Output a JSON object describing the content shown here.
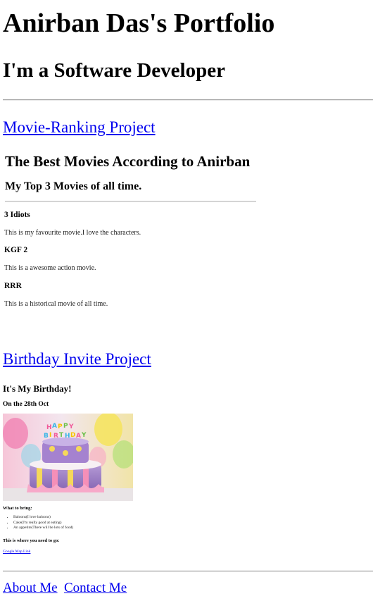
{
  "header": {
    "title": "Anirban Das's Portfolio",
    "subtitle": "I'm a Software Developer"
  },
  "projects": {
    "movie_link": "Movie-Ranking Project",
    "birthday_link": "Birthday Invite Project"
  },
  "movie_ranking": {
    "heading": "The Best Movies According to Anirban",
    "subheading": "My Top 3 Movies of all time.",
    "movies": [
      {
        "title": "3 Idiots",
        "description": "This is my favourite movie.I love the characters."
      },
      {
        "title": "KGF 2",
        "description": "This is a awesome action movie."
      },
      {
        "title": "RRR",
        "description": "This is a historical movie of all time."
      }
    ]
  },
  "birthday_invite": {
    "heading": "It's My Birthday!",
    "date": "On the 28th Oct",
    "image_text": "HAPPY BIRTHDAY",
    "bring_label": "What to bring:",
    "items": [
      "Baloons(I love baloons)",
      "Cake(I'm really good at eating)",
      "An appetite(There will be lots of food)"
    ],
    "where_label": "This is where you need to go:",
    "map_link": "Google Map Link"
  },
  "footer": {
    "about_link": "About Me",
    "contact_link": "Contact Me"
  },
  "colors": {
    "link": "#0000ee",
    "divider": "#a0a0a0",
    "text": "#000000"
  }
}
